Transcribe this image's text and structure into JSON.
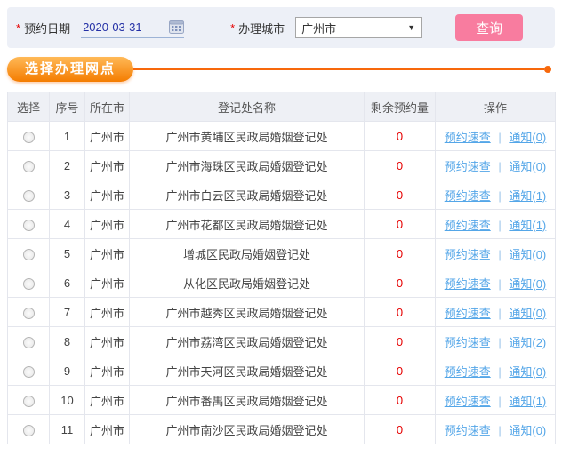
{
  "form": {
    "required_marker": "*",
    "date_label": "预约日期",
    "date_value": "2020-03-31",
    "city_label": "办理城市",
    "city_value": "广州市",
    "dropdown_arrow": "▼",
    "query_button_label": "查询"
  },
  "section": {
    "title": "选择办理网点"
  },
  "table": {
    "headers": [
      "选择",
      "序号",
      "所在市",
      "登记处名称",
      "剩余预约量",
      "操作"
    ],
    "action_quick_label": "预约速查",
    "action_separator": "|",
    "action_notify_label": "通知",
    "rows": [
      {
        "seq": "1",
        "city": "广州市",
        "name": "广州市黄埔区民政局婚姻登记处",
        "remaining": "0",
        "notify_count": "0"
      },
      {
        "seq": "2",
        "city": "广州市",
        "name": "广州市海珠区民政局婚姻登记处",
        "remaining": "0",
        "notify_count": "0"
      },
      {
        "seq": "3",
        "city": "广州市",
        "name": "广州市白云区民政局婚姻登记处",
        "remaining": "0",
        "notify_count": "1"
      },
      {
        "seq": "4",
        "city": "广州市",
        "name": "广州市花都区民政局婚姻登记处",
        "remaining": "0",
        "notify_count": "1"
      },
      {
        "seq": "5",
        "city": "广州市",
        "name": "增城区民政局婚姻登记处",
        "remaining": "0",
        "notify_count": "0"
      },
      {
        "seq": "6",
        "city": "广州市",
        "name": "从化区民政局婚姻登记处",
        "remaining": "0",
        "notify_count": "0"
      },
      {
        "seq": "7",
        "city": "广州市",
        "name": "广州市越秀区民政局婚姻登记处",
        "remaining": "0",
        "notify_count": "0"
      },
      {
        "seq": "8",
        "city": "广州市",
        "name": "广州市荔湾区民政局婚姻登记处",
        "remaining": "0",
        "notify_count": "2"
      },
      {
        "seq": "9",
        "city": "广州市",
        "name": "广州市天河区民政局婚姻登记处",
        "remaining": "0",
        "notify_count": "0"
      },
      {
        "seq": "10",
        "city": "广州市",
        "name": "广州市番禺区民政局婚姻登记处",
        "remaining": "0",
        "notify_count": "1"
      },
      {
        "seq": "11",
        "city": "广州市",
        "name": "广州市南沙区民政局婚姻登记处",
        "remaining": "0",
        "notify_count": "0"
      }
    ]
  },
  "colors": {
    "accent_orange": "#f7680c",
    "badge_gradient_top": "#ffb957",
    "badge_gradient_bottom": "#f47c00",
    "button_pink": "#f87c9f",
    "link_blue": "#54a6e8",
    "remaining_red": "#e60000",
    "date_text_blue": "#2430a6",
    "bar_background": "#edf0f7",
    "header_background": "#eef0f5"
  }
}
